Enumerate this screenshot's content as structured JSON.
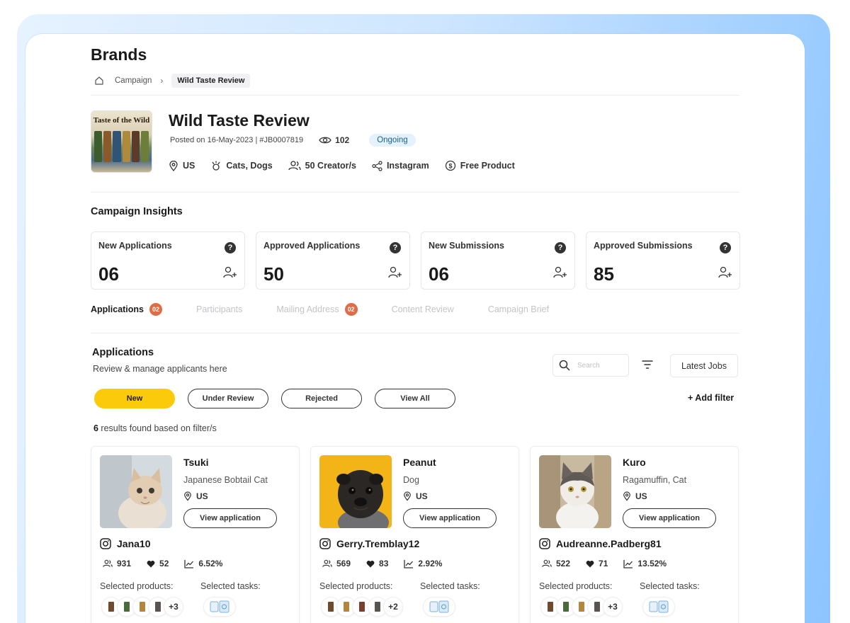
{
  "page": {
    "title": "Brands"
  },
  "breadcrumb": {
    "home_icon": "home-icon",
    "items": [
      "Campaign",
      "Wild Taste Review"
    ]
  },
  "campaign": {
    "thumbnail_text": "Taste of the Wild",
    "title": "Wild Taste Review",
    "posted": "Posted on 16-May-2023 | #JB0007819",
    "views": "102",
    "status": "Ongoing",
    "tags": {
      "location": "US",
      "pets": "Cats, Dogs",
      "creators": "50 Creator/s",
      "platform": "Instagram",
      "compensation": "Free Product"
    }
  },
  "insights": {
    "title": "Campaign Insights",
    "cards": [
      {
        "label": "New Applications",
        "value": "06",
        "help": "?"
      },
      {
        "label": "Approved Applications",
        "value": "50",
        "help": "?"
      },
      {
        "label": "New Submissions",
        "value": "06",
        "help": "?"
      },
      {
        "label": "Approved Submissions",
        "value": "85",
        "help": "?"
      }
    ]
  },
  "tabs": [
    {
      "label": "Applications",
      "count": "02"
    },
    {
      "label": "Participants"
    },
    {
      "label": "Mailing Address",
      "count": "02"
    },
    {
      "label": "Content Review"
    },
    {
      "label": "Campaign Brief"
    }
  ],
  "applications": {
    "title": "Applications",
    "subtitle": "Review & manage applicants here",
    "search_placeholder": "Search",
    "sort_label": "Latest Jobs",
    "filters": [
      "New",
      "Under Review",
      "Rejected",
      "View All"
    ],
    "add_filter": "+ Add filter",
    "results_count": "6",
    "results_text": " results found based on filter/s"
  },
  "cards": [
    {
      "name": "Tsuki",
      "breed": "Japanese Bobtail Cat",
      "location": "US",
      "view_label": "View application",
      "handle": "Jana10",
      "followers": "931",
      "likes": "52",
      "engagement": "6.52%",
      "products_label": "Selected products:",
      "tasks_label": "Selected tasks:",
      "more_products": "+3"
    },
    {
      "name": "Peanut",
      "breed": "Dog",
      "location": "US",
      "view_label": "View application",
      "handle": "Gerry.Tremblay12",
      "followers": "569",
      "likes": "83",
      "engagement": "2.92%",
      "products_label": "Selected products:",
      "tasks_label": "Selected tasks:",
      "more_products": "+2"
    },
    {
      "name": "Kuro",
      "breed": "Ragamuffin, Cat",
      "location": "US",
      "view_label": "View application",
      "handle": "Audreanne.Padberg81",
      "followers": "522",
      "likes": "71",
      "engagement": "13.52%",
      "products_label": "Selected products:",
      "tasks_label": "Selected tasks:",
      "more_products": "+3"
    }
  ],
  "colors": {
    "accent_yellow": "#fbca0b",
    "badge_orange": "#e06b45",
    "status_bg": "#e3f2fc",
    "frame_blue": "#8cc4ff"
  }
}
